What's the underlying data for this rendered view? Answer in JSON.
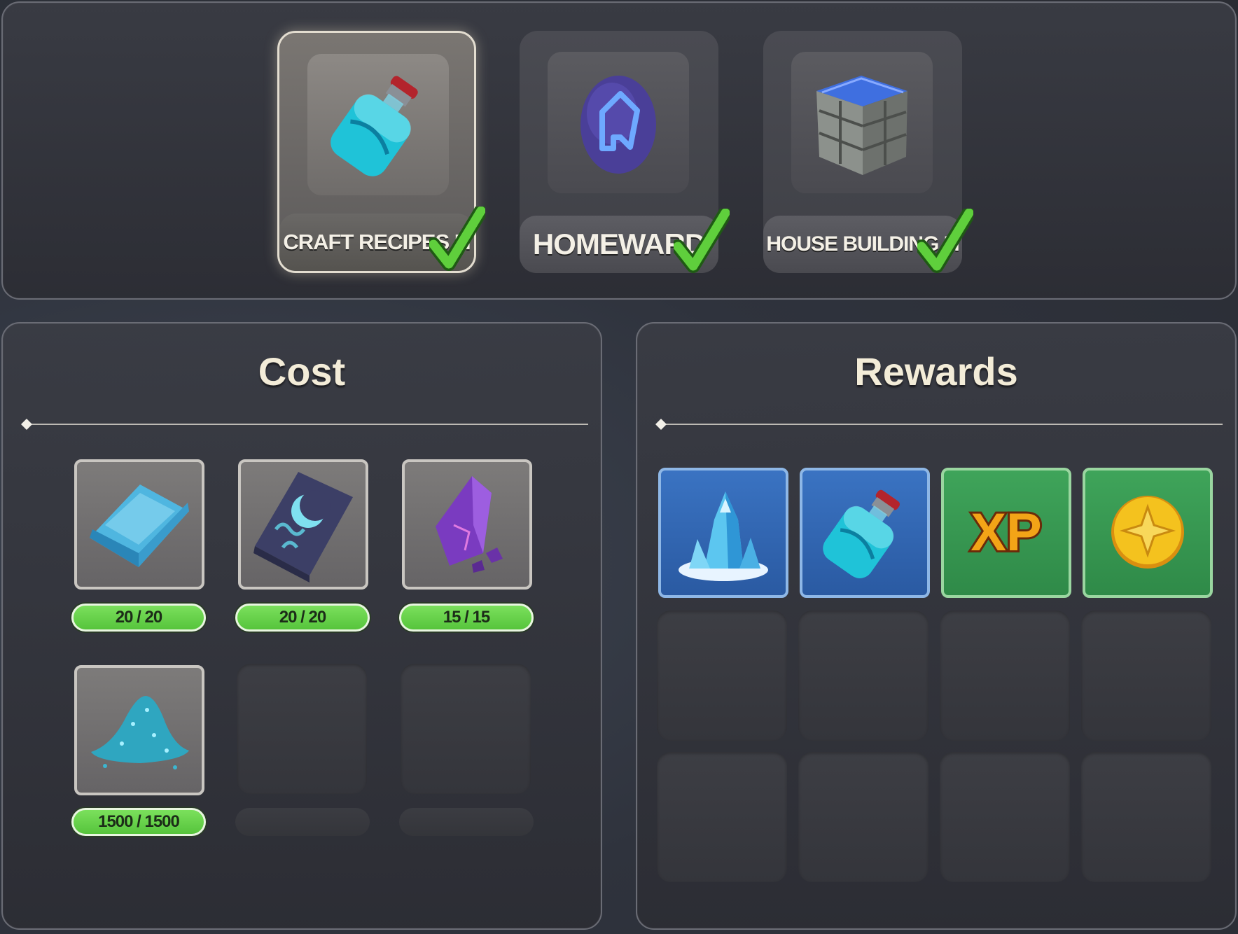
{
  "unlocks": [
    {
      "label": "CRAFT RECIPES III",
      "icon": "potion-bottle-icon",
      "selected": true,
      "completed": true
    },
    {
      "label": "HOMEWARD",
      "icon": "homeward-rune-stone-icon",
      "selected": false,
      "completed": true
    },
    {
      "label": "HOUSE BUILDING III",
      "icon": "stone-block-icon",
      "selected": false,
      "completed": true
    }
  ],
  "cost": {
    "title": "Cost",
    "items": [
      {
        "icon": "crystal-ingot-icon",
        "quantity": "20 / 20"
      },
      {
        "icon": "moon-rune-tablet-icon",
        "quantity": "20 / 20"
      },
      {
        "icon": "purple-crystal-shard-icon",
        "quantity": "15 / 15"
      },
      {
        "icon": "blue-dust-pile-icon",
        "quantity": "1500 / 1500"
      }
    ]
  },
  "rewards": {
    "title": "Rewards",
    "items": [
      {
        "icon": "ice-crystal-icon",
        "frame": "blue"
      },
      {
        "icon": "potion-bottle-icon",
        "frame": "blue"
      },
      {
        "icon": "xp-icon",
        "frame": "green",
        "text": "XP"
      },
      {
        "icon": "gold-coin-icon",
        "frame": "green"
      }
    ]
  },
  "colors": {
    "quantity_pill": "#6bd34c",
    "reward_blue": "#3a73c2",
    "reward_green": "#3fa45a",
    "check": "#5fcf3c"
  }
}
